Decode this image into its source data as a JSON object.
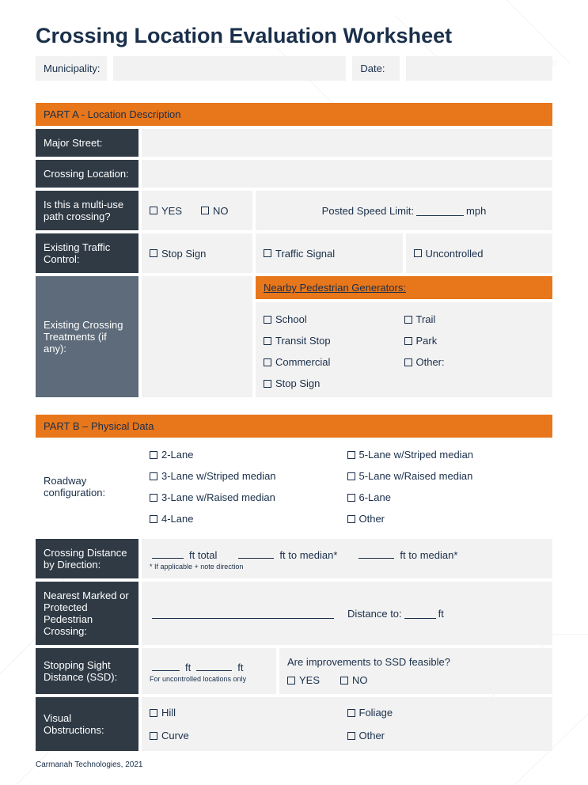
{
  "title": "Crossing Location Evaluation Worksheet",
  "top": {
    "municipality_label": "Municipality:",
    "date_label": "Date:"
  },
  "partA": {
    "header": "PART A - Location Description",
    "major_street_label": "Major Street:",
    "crossing_location_label": "Crossing Location:",
    "multi_use_label": "Is this  a multi-use path crossing?",
    "yes": "YES",
    "no": "NO",
    "posted_speed_label": "Posted Speed Limit:",
    "mph": "mph",
    "existing_traffic_label": "Existing Traffic Control:",
    "stop_sign": "Stop Sign",
    "traffic_signal": "Traffic Signal",
    "uncontrolled": "Uncontrolled",
    "existing_crossing_label": "Existing Crossing Treatments (if any):",
    "ped_gen_header": "Nearby Pedestrian Generators:",
    "ped_gen": {
      "school": "School",
      "transit": "Transit Stop",
      "commercial": "Commercial",
      "stop_sign2": "Stop Sign",
      "trail": "Trail",
      "park": "Park",
      "other": "Other:"
    }
  },
  "partB": {
    "header": "PART B – Physical Data",
    "roadway_label": "Roadway configuration:",
    "lanes": {
      "l2": "2-Lane",
      "l3s": "3-Lane w/Striped median",
      "l3r": "3-Lane w/Raised median",
      "l4": "4-Lane",
      "l5s": "5-Lane w/Striped median",
      "l5r": "5-Lane w/Raised median",
      "l6": "6-Lane",
      "other": "Other"
    },
    "crossing_dist_label": "Crossing Distance by Direction:",
    "ft_total": "ft total",
    "ft_median": "ft to median*",
    "cd_note": "* If applicable + note direction",
    "nearest_label": "Nearest Marked or Protected Pedestrian Crossing:",
    "distance_to": "Distance to:",
    "ft": "ft",
    "ssd_label": "Stopping Sight Distance (SSD):",
    "ssd_note": "For uncontrolled locations only",
    "ssd_improve": "Are improvements to SSD feasible?",
    "vis_obs_label": "Visual Obstructions:",
    "hill": "Hill",
    "curve": "Curve",
    "foliage": "Foliage",
    "other2": "Other"
  },
  "footer": "Carmanah Technologies, 2021"
}
